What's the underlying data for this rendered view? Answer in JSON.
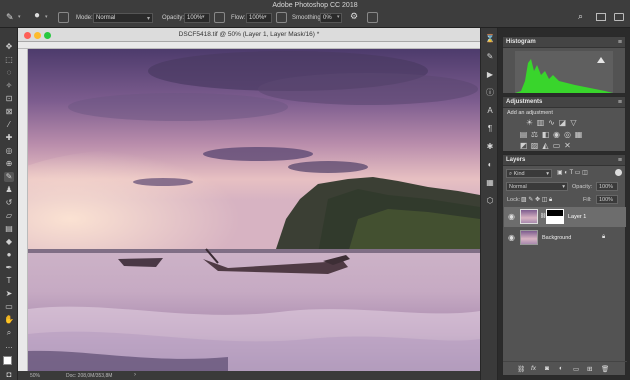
{
  "app": {
    "title": "Adobe Photoshop CC 2018"
  },
  "options_bar": {
    "mode_label": "Mode:",
    "mode_value": "Normal",
    "opacity_label": "Opacity:",
    "opacity_value": "100%",
    "flow_label": "Flow:",
    "flow_value": "100%",
    "smoothing_label": "Smoothing:",
    "smoothing_value": "0%"
  },
  "document": {
    "title": "DSCF5418.tif @ 50% (Layer 1, Layer Mask/16) *",
    "zoom": "50%",
    "doc_info": "Doc: 208,0M/353,8M"
  },
  "panels": {
    "histogram": {
      "tab": "Histogram"
    },
    "adjustments": {
      "tab": "Adjustments",
      "subtitle": "Add an adjustment"
    },
    "layers": {
      "tab": "Layers",
      "filter_value": "Kind",
      "blend_mode": "Normal",
      "opacity_label": "Opacity:",
      "opacity_value": "100%",
      "lock_label": "Lock:",
      "fill_label": "Fill:",
      "fill_value": "100%",
      "items": [
        {
          "name": "Layer 1",
          "selected": true
        },
        {
          "name": "Background",
          "selected": false
        }
      ]
    }
  },
  "colors": {
    "histogram_fill": "#39d52c",
    "accent_selected": "#6d6d6d"
  }
}
